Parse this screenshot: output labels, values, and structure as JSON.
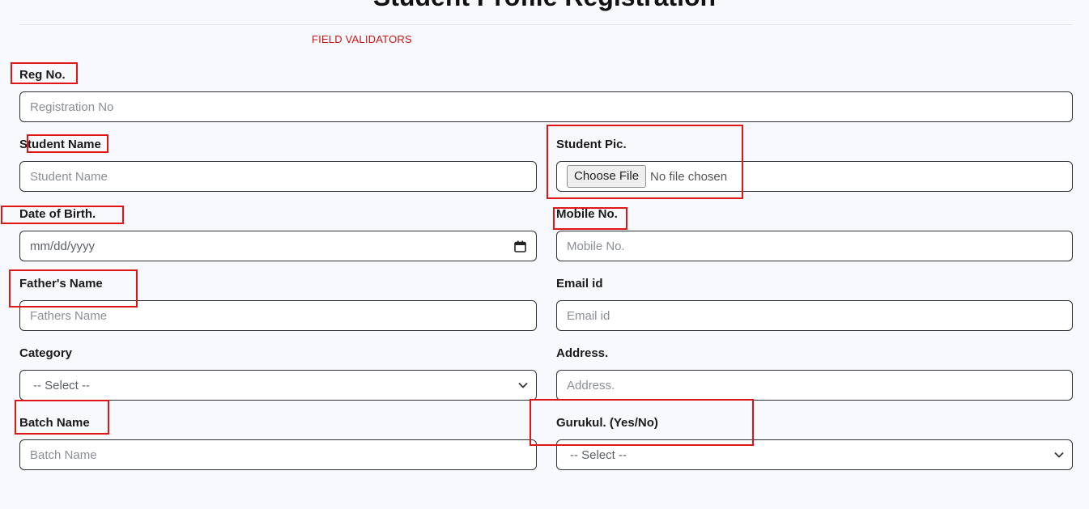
{
  "page": {
    "title": "Student Profile Registration",
    "validators_label": "FIELD VALIDATORS"
  },
  "form": {
    "reg_no": {
      "label": "Reg No.",
      "placeholder": "Registration No"
    },
    "student_name": {
      "label": "Student Name",
      "placeholder": "Student Name"
    },
    "student_pic": {
      "label": "Student Pic.",
      "button": "Choose File",
      "status": "No file chosen"
    },
    "dob": {
      "label": "Date of Birth.",
      "placeholder": "mm/dd/yyyy",
      "icon": "calendar-icon"
    },
    "mobile": {
      "label": "Mobile No.",
      "placeholder": "Mobile No."
    },
    "father_name": {
      "label": "Father's Name",
      "placeholder": "Fathers Name"
    },
    "email": {
      "label": "Email id",
      "placeholder": "Email id"
    },
    "category": {
      "label": "Category",
      "selected": "-- Select --",
      "icon": "chevron-down-icon"
    },
    "address": {
      "label": "Address.",
      "placeholder": "Address."
    },
    "batch_name": {
      "label": "Batch Name",
      "placeholder": "Batch Name"
    },
    "gurukul": {
      "label": "Gurukul. (Yes/No)",
      "selected": "-- Select --",
      "icon": "chevron-down-icon"
    }
  },
  "colors": {
    "highlight": "#e01515",
    "validators_text": "#cc1414",
    "background": "#f8f9fc",
    "field_border": "#2f3337"
  }
}
